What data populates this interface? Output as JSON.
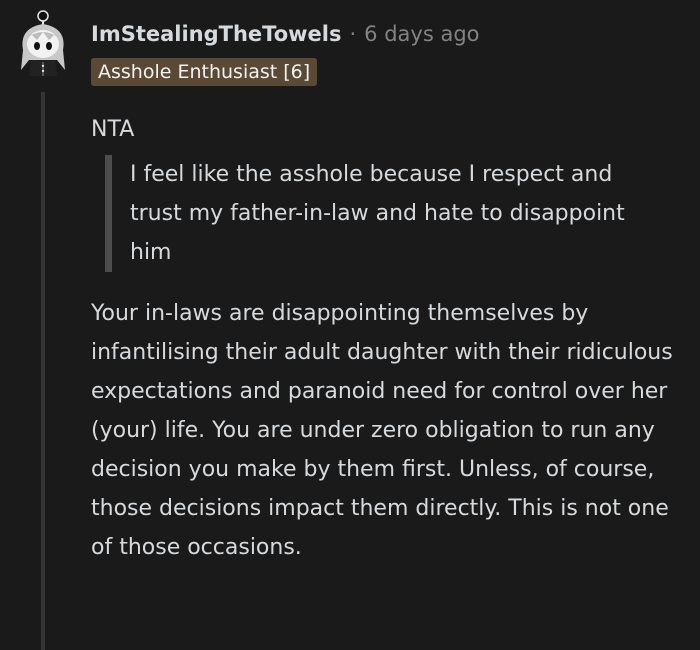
{
  "comment": {
    "username": "ImStealingTheTowels",
    "separator": "·",
    "time": "6 days ago",
    "flair": "Asshole Enthusiast [6]",
    "body": {
      "verdict": "NTA",
      "quote": "I feel like the asshole because I respect and trust my father-in-law and hate to disappoint him",
      "paragraph": "Your in-laws are disappointing themselves by infantilising their adult daughter with their ridiculous expectations and paranoid need for control over her (your) life. You are under zero obligation to run any decision you make by them first. Unless, of course, those decisions impact them directly. This is not one of those occasions."
    }
  },
  "avatar": {
    "icon": "snoo-avatar-icon",
    "hair_color": "#c8c8c8",
    "eye_color": "#111111"
  },
  "colors": {
    "background": "#1a1a1b",
    "text": "#d7dadc",
    "muted": "#818384",
    "flair_bg": "#5a4a35",
    "quote_bar": "#4d4d4d"
  }
}
